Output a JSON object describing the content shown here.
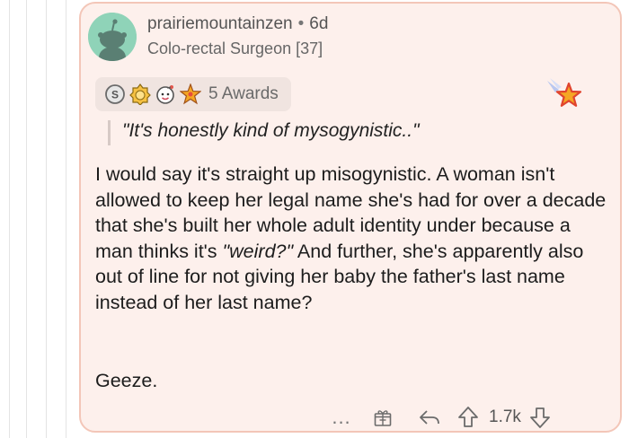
{
  "comment": {
    "username": "prairiemountainzen",
    "separator": "•",
    "age": "6d",
    "flair": "Colo-rectal Surgeon [37]",
    "awards": {
      "label": "5 Awards",
      "icons": [
        "silver-award-icon",
        "gold-medal-award-icon",
        "wholesome-award-icon",
        "rocket-like-award-icon"
      ]
    },
    "quote": "\"It's honestly kind of mysogynistic..\"",
    "body_before_emph": "I would say it's straight up misogynistic. A woman isn't allowed to keep her legal name she's had for over a decade that she's built her whole adult identity under because a man thinks it's ",
    "body_emph": "\"weird?\"",
    "body_after_emph": " And further, she's apparently also out of line for not giving her baby the father's last name instead of her last name?",
    "closing": "Geeze.",
    "actions": {
      "more_label": "...",
      "vote_count": "1.7k"
    }
  },
  "colors": {
    "card_background": "#fdf0ec",
    "card_border": "#f3c6b8",
    "avatar_background": "#8fd3b8",
    "star_orange": "#f5a623"
  }
}
